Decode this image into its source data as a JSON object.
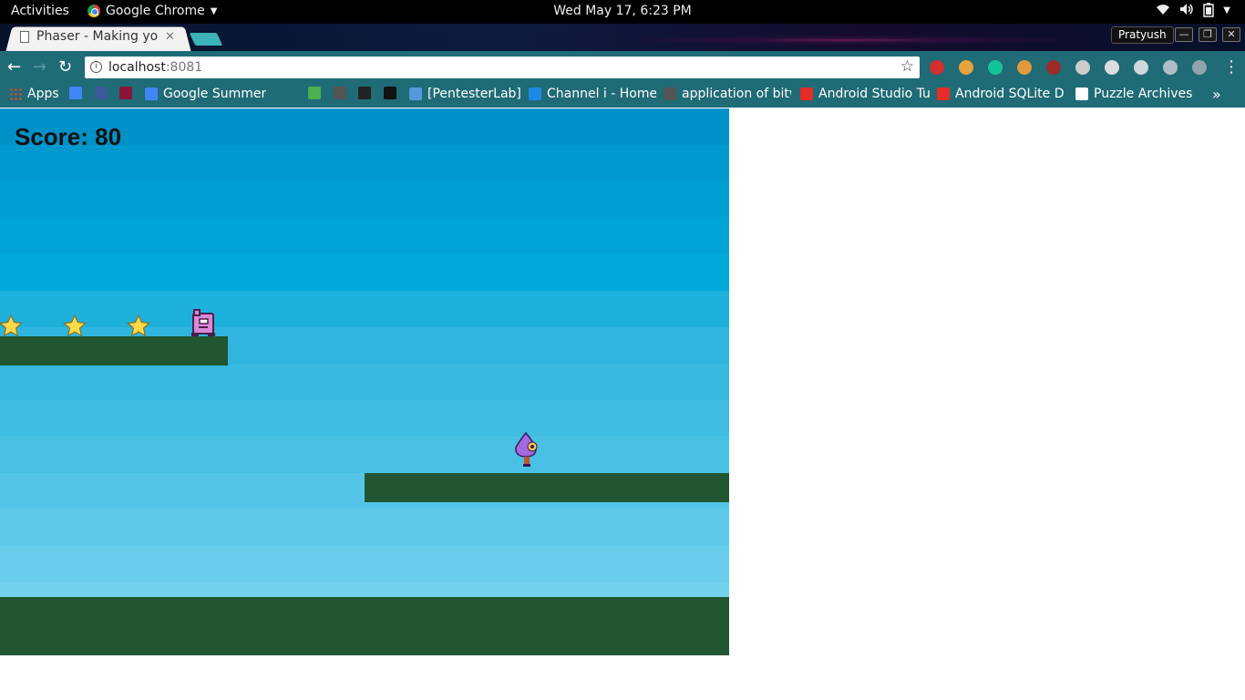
{
  "system_bar": {
    "activities": "Activities",
    "app_name": "Google Chrome",
    "clock": "Wed May 17,  6:23 PM"
  },
  "browser": {
    "tab_title": "Phaser - Making yo",
    "profile_name": "Pratyush",
    "url_host": "localhost",
    "url_port": ":8081",
    "extensions": [
      "adblock-plus-icon",
      "bowl-icon",
      "grammarly-icon",
      "cookie-icon",
      "record-icon",
      "circle-icon",
      "page-icon",
      "pocket-icon",
      "off-badge-icon",
      "pin-icon"
    ],
    "bookmarks": [
      {
        "label": "Apps",
        "color": "#db4437"
      },
      {
        "label": "",
        "color": "#4285f4"
      },
      {
        "label": "",
        "color": "#3b5998"
      },
      {
        "label": "",
        "color": "#8a1538"
      },
      {
        "label": "Google Summer",
        "color": "#4285f4"
      },
      {
        "label": "",
        "color": "#1f6b76"
      },
      {
        "label": "",
        "color": "#4caf50"
      },
      {
        "label": "",
        "color": "#555555"
      },
      {
        "label": "",
        "color": "#222222"
      },
      {
        "label": "",
        "color": "#111111"
      },
      {
        "label": "[PentesterLab]",
        "color": "#5599dd"
      },
      {
        "label": "Channel i - Home",
        "color": "#1e88e5"
      },
      {
        "label": "application of bitw",
        "color": "#555555"
      },
      {
        "label": "Android Studio Tu",
        "color": "#e52d27"
      },
      {
        "label": "Android SQLite D",
        "color": "#e52d27"
      },
      {
        "label": "Puzzle Archives -",
        "color": "#ffffff"
      }
    ]
  },
  "game": {
    "score_text": "Score: 80",
    "colors": {
      "platform": "#225532",
      "star": "#ffd94a"
    }
  }
}
